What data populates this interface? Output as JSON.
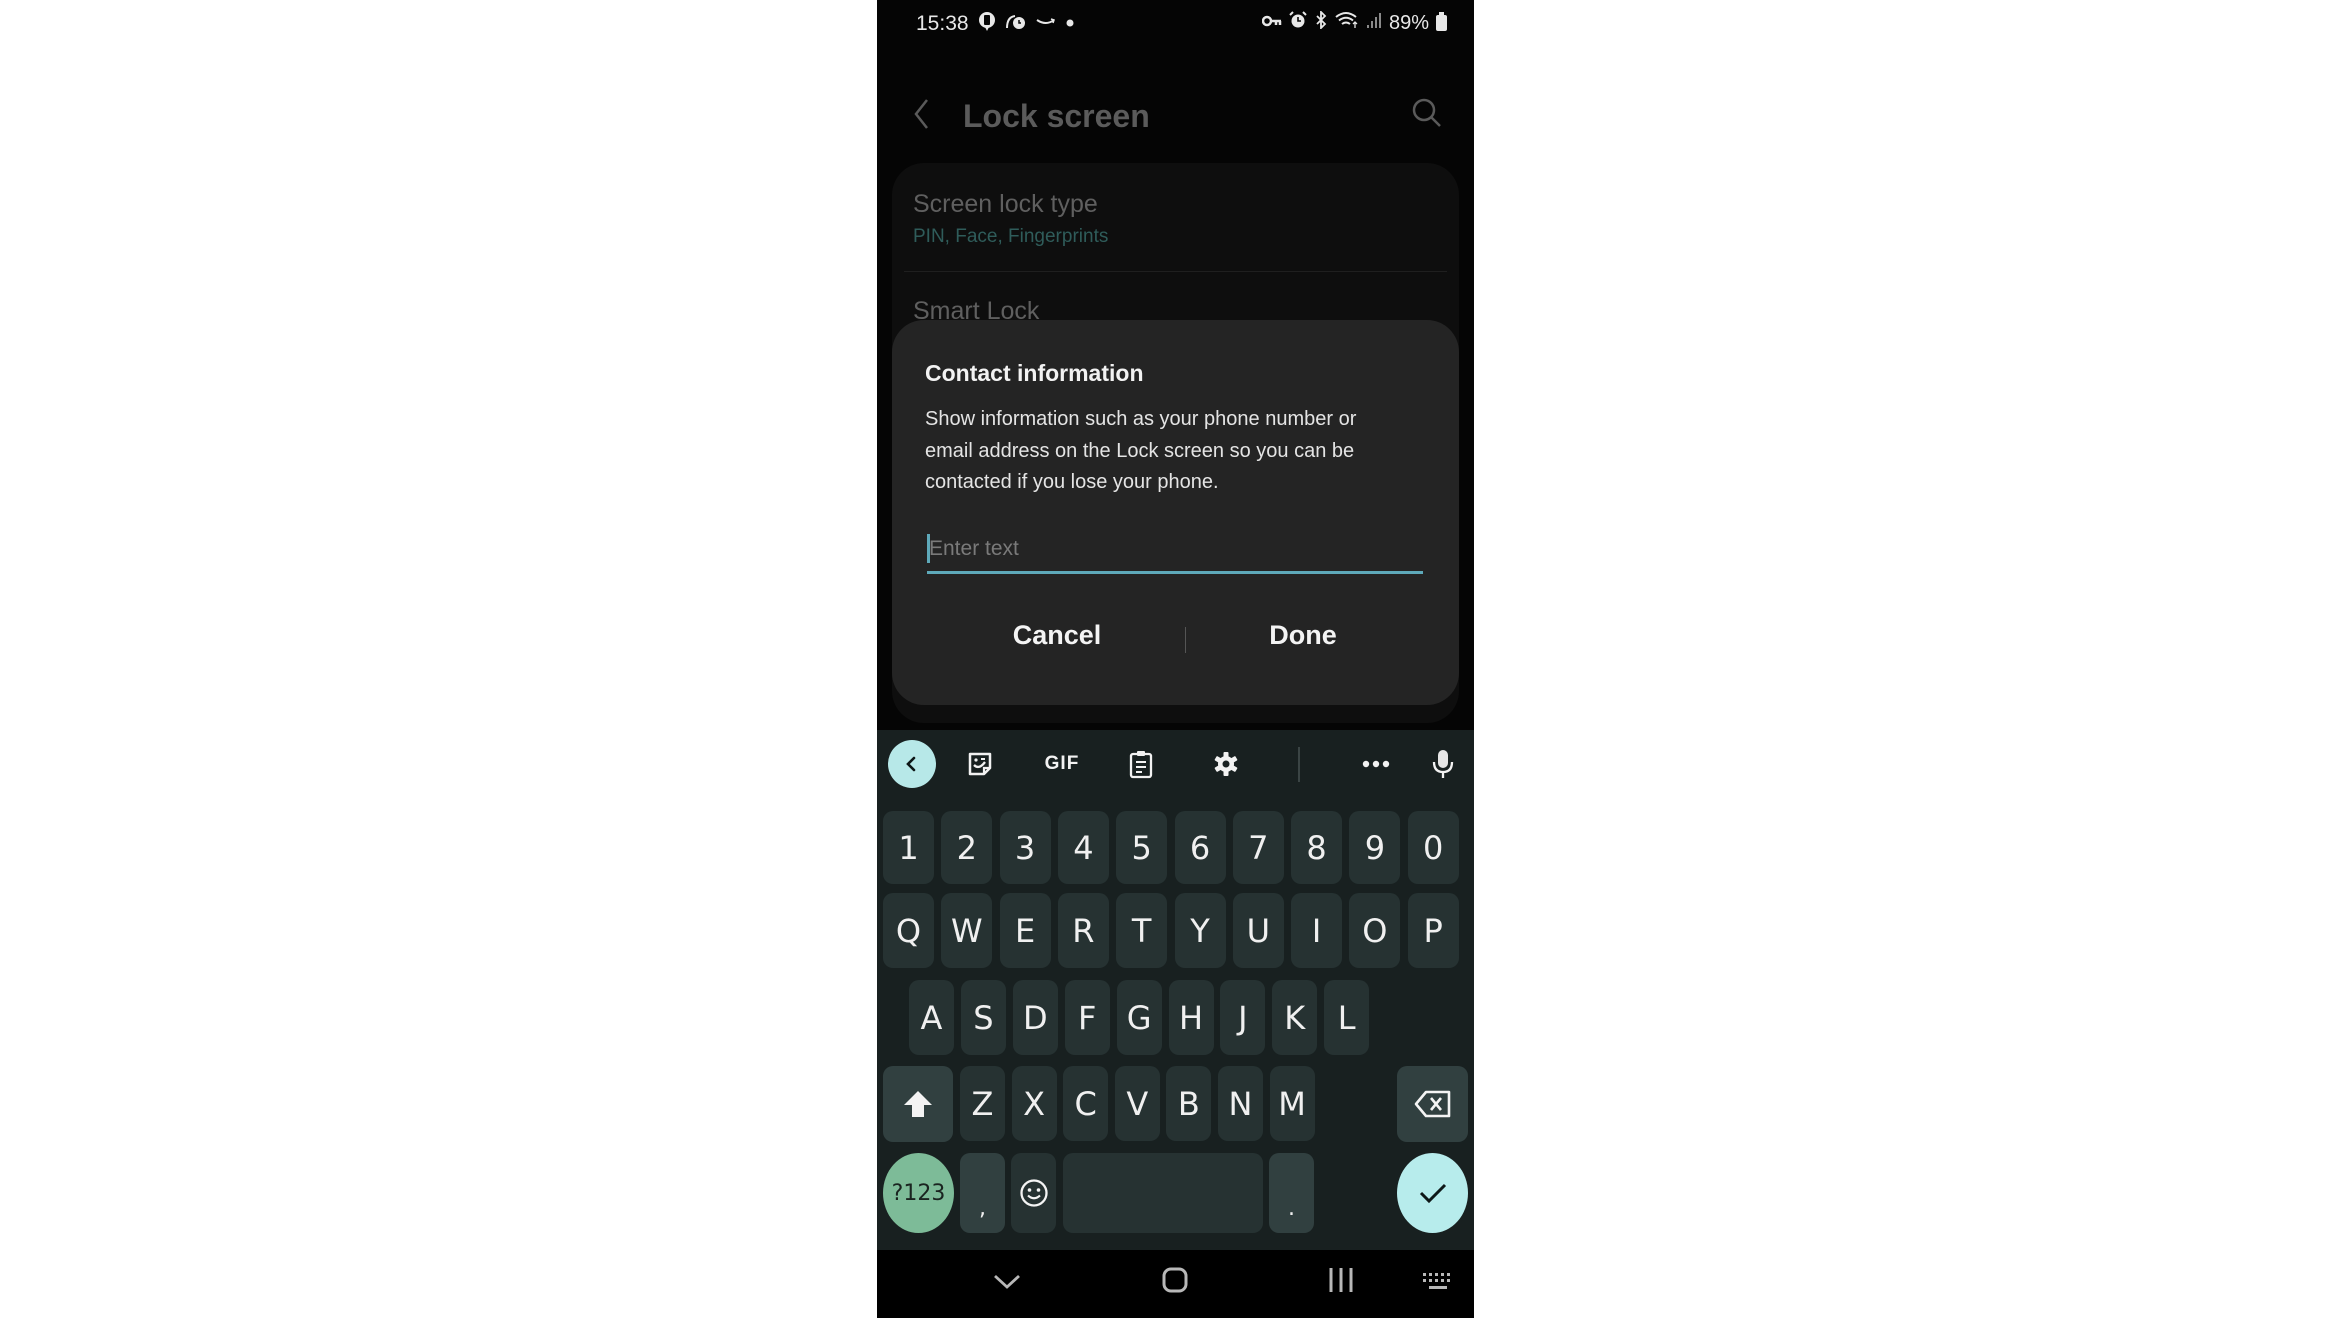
{
  "status_bar": {
    "time": "15:38",
    "left_icons": [
      "notification-badge-icon",
      "wellbeing-icon",
      "amazon-icon",
      "dot-icon"
    ],
    "right_icons": [
      "vpn-key-icon",
      "alarm-icon",
      "bluetooth-icon",
      "wifi-icon",
      "signal-icon"
    ],
    "battery": "89%"
  },
  "app_bar": {
    "title": "Lock screen"
  },
  "settings": {
    "items": [
      {
        "title": "Screen lock type",
        "subtitle": "PIN, Face, Fingerprints"
      },
      {
        "title": "Smart Lock"
      }
    ]
  },
  "dialog": {
    "title": "Contact information",
    "body": "Show information such as your phone number or email address on the Lock screen so you can be contacted if you lose your phone.",
    "input_value": "",
    "input_placeholder": "Enter text",
    "cancel_label": "Cancel",
    "done_label": "Done"
  },
  "keyboard": {
    "toolbar": {
      "gif_label": "GIF"
    },
    "rows": {
      "numbers": [
        "1",
        "2",
        "3",
        "4",
        "5",
        "6",
        "7",
        "8",
        "9",
        "0"
      ],
      "row1": [
        "Q",
        "W",
        "E",
        "R",
        "T",
        "Y",
        "U",
        "I",
        "O",
        "P"
      ],
      "row2": [
        "A",
        "S",
        "D",
        "F",
        "G",
        "H",
        "J",
        "K",
        "L"
      ],
      "row3": [
        "Z",
        "X",
        "C",
        "V",
        "B",
        "N",
        "M"
      ]
    },
    "symbols_label": "?123",
    "comma_label": ",",
    "period_label": ".",
    "accent_colors": {
      "back": "#b7e8e8",
      "symbols": "#7dbb98",
      "enter": "#b7ecec",
      "input_underline": "#5ea9ba"
    }
  }
}
